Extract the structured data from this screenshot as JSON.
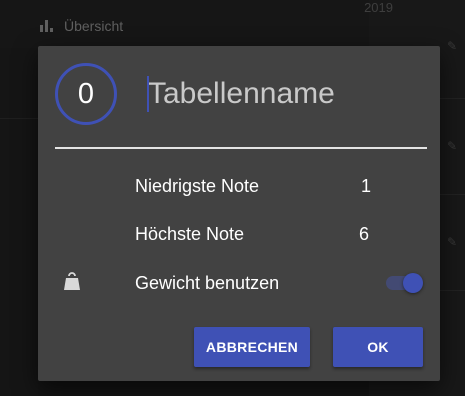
{
  "background": {
    "nav_title": "Übersicht",
    "year_label": "2019",
    "nav_icon": "bar-chart-icon",
    "row_icon": "pencil-icon"
  },
  "dialog": {
    "count": "0",
    "name_placeholder": "Tabellenname",
    "rows": [
      {
        "label": "Niedrigste Note",
        "value": "1"
      },
      {
        "label": "Höchste Note",
        "value": "6"
      }
    ],
    "weight": {
      "icon": "weight-icon",
      "label": "Gewicht benutzen",
      "enabled": true
    },
    "buttons": {
      "cancel": "ABBRECHEN",
      "ok": "OK"
    }
  },
  "colors": {
    "accent": "#3f51b5",
    "dialog_bg": "#424242",
    "text": "#ffffff"
  }
}
